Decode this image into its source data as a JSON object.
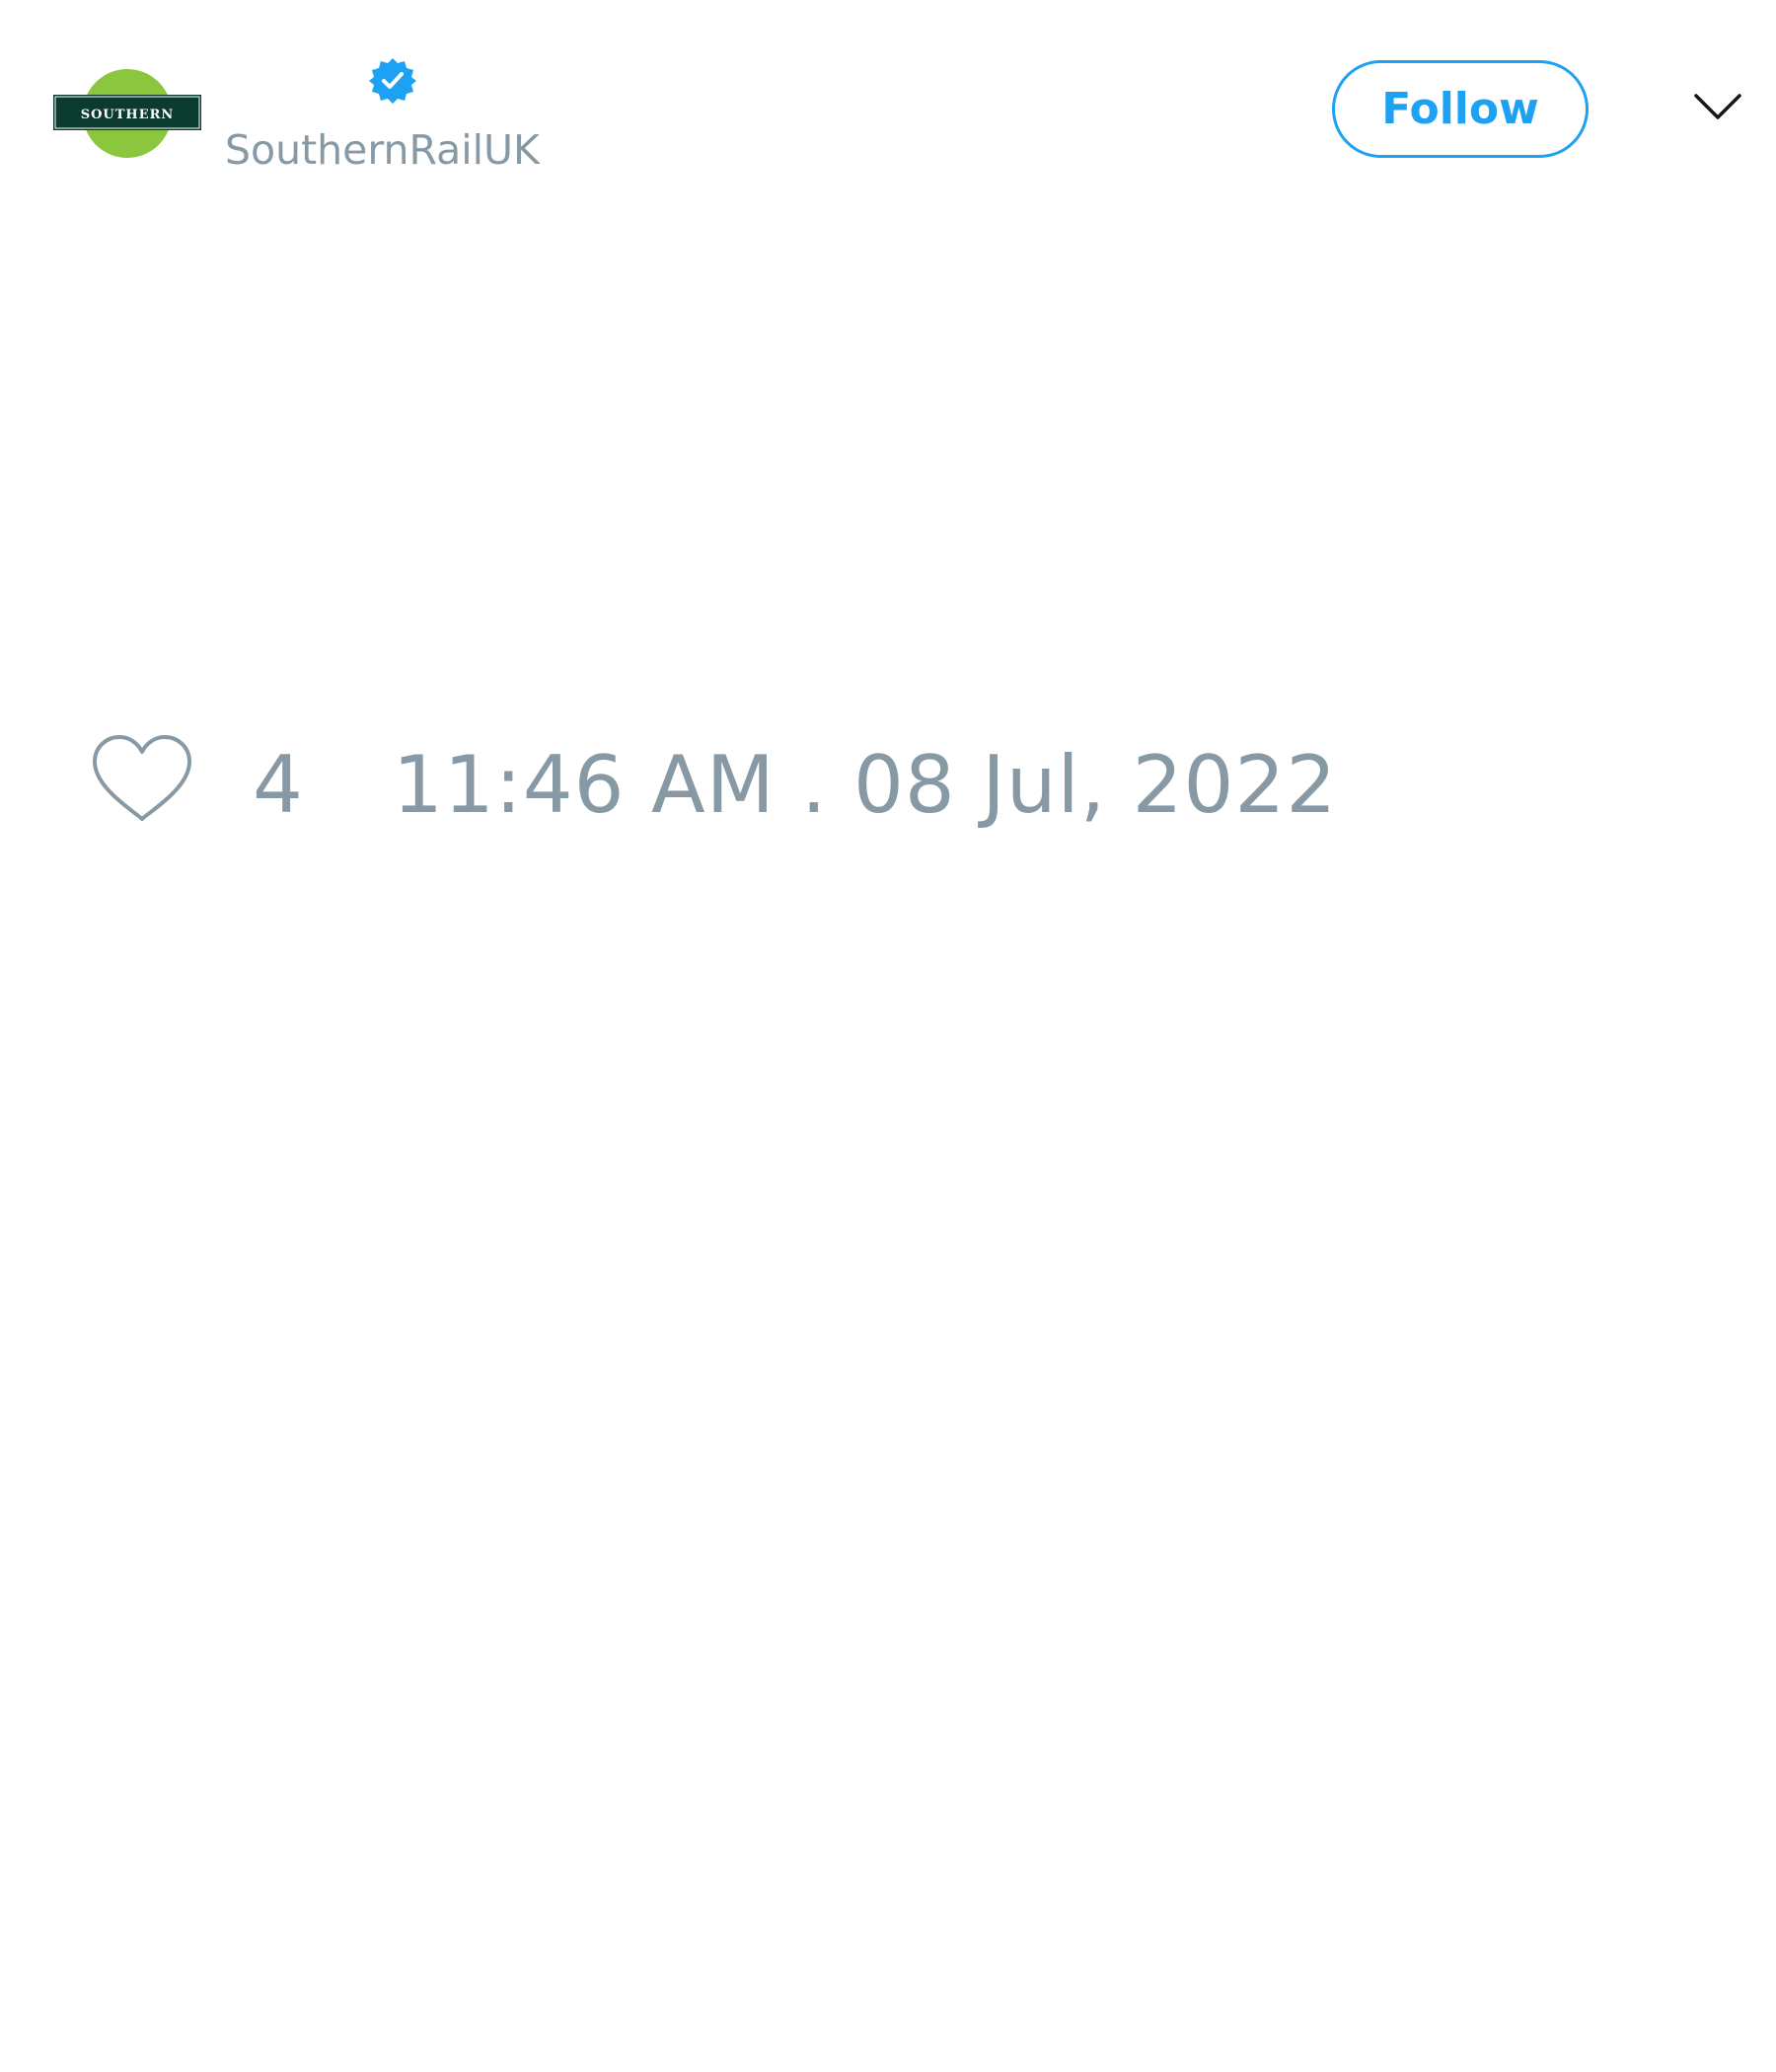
{
  "tweet": {
    "author": {
      "avatar_logo_text": "SOUTHERN",
      "avatar_icon": "southern-rail-logo",
      "handle": "SouthernRailUK",
      "verified": true,
      "verified_icon": "verified-badge-icon"
    },
    "actions": {
      "follow_label": "Follow",
      "menu_icon": "chevron-down-icon"
    },
    "footer": {
      "like_icon": "heart-outline-icon",
      "like_count": "4",
      "timestamp": "11:46 AM . 08 Jul, 2022"
    }
  },
  "colors": {
    "accent": "#1da1f2",
    "muted_text": "#8899a6",
    "logo_green": "#8cc63f",
    "logo_dark": "#0b3b2e"
  }
}
